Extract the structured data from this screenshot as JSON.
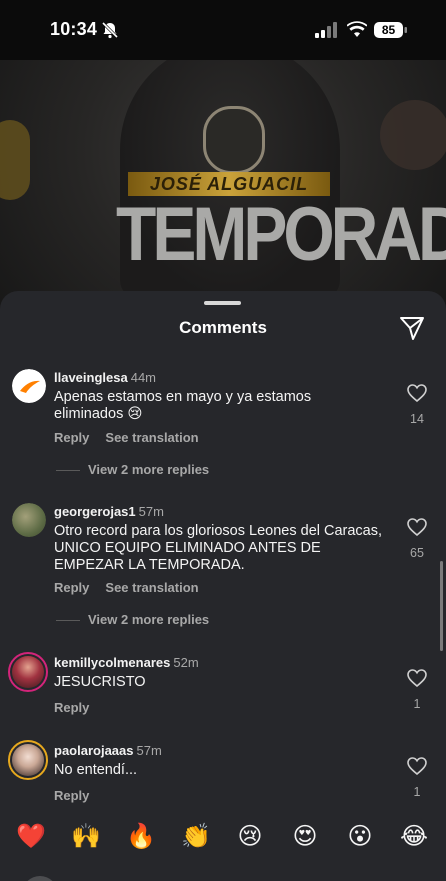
{
  "status_bar": {
    "time": "10:34",
    "battery": "85"
  },
  "video": {
    "banner_name": "JOSÉ ALGUACIL",
    "banner_title": "TEMPORADA"
  },
  "sheet": {
    "title": "Comments"
  },
  "comments": [
    {
      "username": "llaveinglesa",
      "time": "44m",
      "text": "Apenas estamos en mayo y ya estamos eliminados 😢",
      "reply_label": "Reply",
      "translate_label": "See translation",
      "likes": "14",
      "view_replies": "View 2 more replies",
      "avatar_color": "#ffffff"
    },
    {
      "username": "georgerojas1",
      "time": "57m",
      "text": "Otro record para los gloriosos Leones del Caracas, UNICO EQUIPO ELIMINADO ANTES DE EMPEZAR LA TEMPORADA.",
      "reply_label": "Reply",
      "translate_label": "See translation",
      "likes": "65",
      "view_replies": "View 2 more replies",
      "avatar_color": "#6f7b55"
    },
    {
      "username": "kemillycolmenares",
      "time": "52m",
      "text": "JESUCRISTO",
      "reply_label": "Reply",
      "likes": "1",
      "avatar_color": "#9b2f3a"
    },
    {
      "username": "paolarojaaas",
      "time": "57m",
      "text": "No entendí...",
      "reply_label": "Reply",
      "likes": "1",
      "avatar_color": "#d9cfc7"
    }
  ],
  "emoji_reactions": [
    "❤️",
    "🙌",
    "🔥",
    "👏",
    "😢",
    "😍",
    "😮",
    "😂"
  ],
  "colors": {
    "sheet_bg": "#26272b",
    "muted_text": "#a8a8a8",
    "story_ring": "#d3247a"
  }
}
